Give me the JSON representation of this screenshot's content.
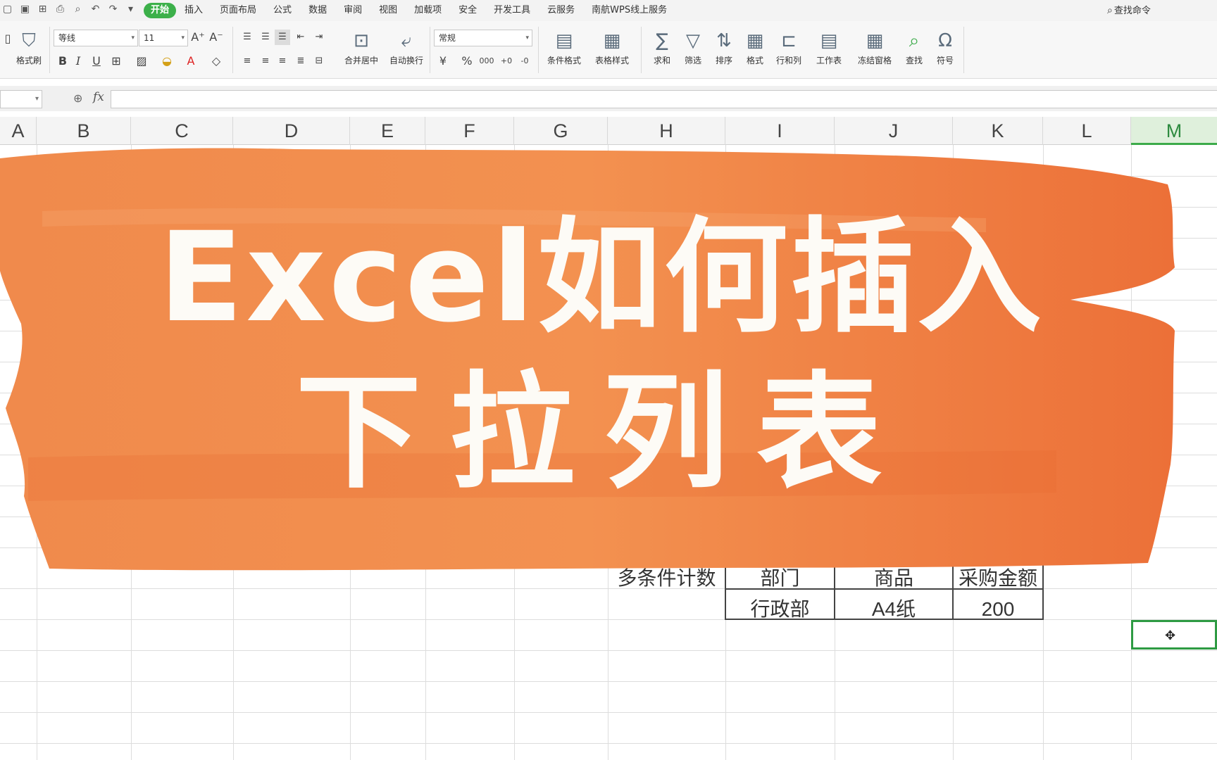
{
  "menubar": {
    "tabs": [
      "开始",
      "插入",
      "页面布局",
      "公式",
      "数据",
      "审阅",
      "视图",
      "加载项",
      "安全",
      "开发工具",
      "云服务",
      "南航WPS线上服务"
    ],
    "search_label": "查找命令"
  },
  "ribbon": {
    "format_painter": "格式刷",
    "font_name": "等线",
    "font_size": "11",
    "number_format": "常规",
    "merge_center": "合并居中",
    "wrap_text": "自动换行",
    "conditional_format": "条件格式",
    "table_style": "表格样式",
    "sum": "求和",
    "filter": "筛选",
    "sort": "排序",
    "format": "格式",
    "row_col": "行和列",
    "worksheet": "工作表",
    "freeze": "冻结窗格",
    "find": "查找",
    "symbol": "符号",
    "bold": "B",
    "italic": "I",
    "underline": "U",
    "font_color_letter": "A",
    "percent": "%"
  },
  "formula_bar": {
    "fx": "fx",
    "value": ""
  },
  "columns": [
    "A",
    "B",
    "C",
    "D",
    "E",
    "F",
    "G",
    "H",
    "I",
    "J",
    "K",
    "L",
    "M"
  ],
  "selected_column": "M",
  "cells": {
    "h_label": "多条件计数",
    "i_header": "部门",
    "j_header": "商品",
    "k_header": "采购金额",
    "i_value": "行政部",
    "j_value": "A4纸",
    "k_value": "200"
  },
  "banner": {
    "line1": "Excel如何插入",
    "line2": "下拉列表",
    "color": "#ef7a3e"
  }
}
